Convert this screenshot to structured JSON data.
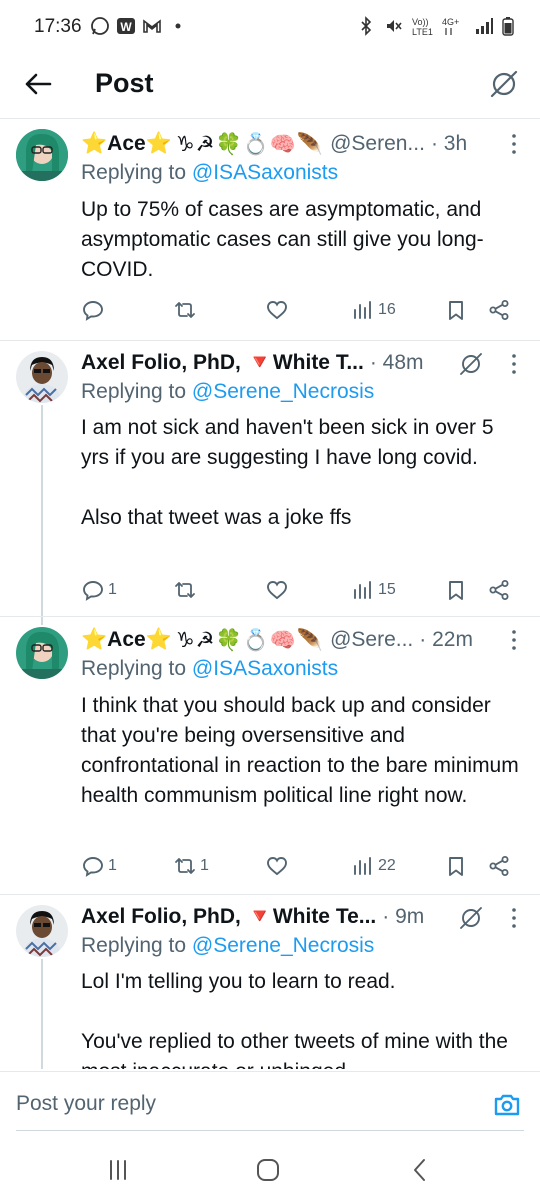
{
  "status_bar": {
    "time": "17:36",
    "left_icons": [
      "whatsapp-icon",
      "w-app-icon",
      "gmail-icon",
      "dot-icon"
    ],
    "right_icons": [
      "bluetooth-icon",
      "mute-icon",
      "volte-icon",
      "signal-icon",
      "battery-icon"
    ],
    "network_label": "Vo)) LTE1",
    "network_type": "4G+"
  },
  "header": {
    "title": "Post"
  },
  "tweets": [
    {
      "name": "⭐Ace⭐",
      "emoji": "♑☭🍀💍🧠🪶",
      "handle": "@Seren...",
      "time": "· 3h",
      "reply_prefix": "Replying to ",
      "reply_to": "@ISASaxonists",
      "body": "Up to 75% of cases are asymptomatic, and asymptomatic cases can still give you long-COVID.",
      "replies": "",
      "reposts": "",
      "views": "16",
      "has_grok": false
    },
    {
      "name": "Axel Folio, PhD, 🔻White T...",
      "emoji": "",
      "handle": "",
      "time": "· 48m",
      "reply_prefix": "Replying to ",
      "reply_to": "@Serene_Necrosis",
      "body": "I am not sick and haven't been sick in over 5 yrs if you are suggesting I have long covid.\n\nAlso that tweet was a joke ffs",
      "replies": "1",
      "reposts": "",
      "views": "15",
      "has_grok": true
    },
    {
      "name": "⭐Ace⭐",
      "emoji": "♑☭🍀💍🧠🪶",
      "handle": "@Sere...",
      "time": "· 22m",
      "reply_prefix": "Replying to ",
      "reply_to": "@ISASaxonists",
      "body": "I think that you should back up and consider that you're being oversensitive and confrontational in reaction to the bare minimum health communism political line right now.",
      "replies": "1",
      "reposts": "1",
      "views": "22",
      "has_grok": false
    },
    {
      "name": "Axel Folio, PhD, 🔻White Te...",
      "emoji": "",
      "handle": "",
      "time": "· 9m",
      "reply_prefix": "Replying to ",
      "reply_to": "@Serene_Necrosis",
      "body": "Lol I'm telling you to learn to read.\n\nYou've replied to other tweets of mine with the most inaccurate or unhinged",
      "replies": "",
      "reposts": "",
      "views": "",
      "has_grok": true
    }
  ],
  "reply_bar": {
    "placeholder": "Post your reply"
  },
  "colors": {
    "accent": "#1d9bf0",
    "text": "#0f1419",
    "muted": "#536471",
    "divider": "#e6e9eb",
    "thread_line": "#cfd9de"
  }
}
